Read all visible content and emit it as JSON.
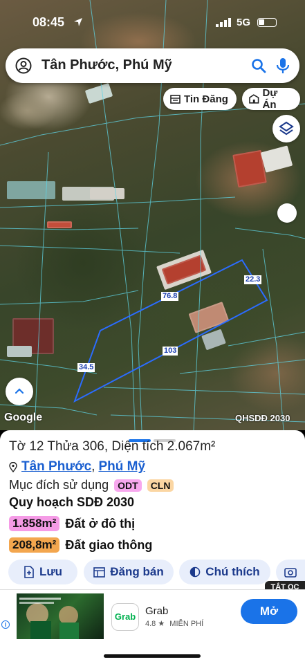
{
  "status_bar": {
    "time": "08:45",
    "network": "5G"
  },
  "search": {
    "text": "Tân Phước, Phú Mỹ"
  },
  "map_chips": {
    "listings": "Tin Đăng",
    "projects": "Dự Án"
  },
  "map": {
    "parcel_dimensions": [
      "76.8",
      "22.3",
      "103",
      "34.5"
    ],
    "google_label": "Google",
    "plan_label": "QHSDĐ 2030",
    "boundary_color": "#2b6cff"
  },
  "sheet": {
    "title": "Tờ 12 Thửa 306, Diện tích 2.067m²",
    "place_ward": "Tân Phước",
    "place_separator": ",",
    "place_town": "Phú Mỹ",
    "purpose_label": "Mục đích sử dụng",
    "purpose_tags": [
      "ODT",
      "CLN"
    ],
    "plan_title": "Quy hoạch SDĐ 2030",
    "areas": [
      {
        "value": "1.858m²",
        "label": "Đất ở đô thị",
        "color": "#f59be6"
      },
      {
        "value": "208,8m²",
        "label": "Đất giao thông",
        "color": "#f3a64e"
      }
    ],
    "actions": {
      "save": "Lưu",
      "post": "Đăng bán",
      "legend": "Chú thích"
    }
  },
  "ad": {
    "close_label": "TẮT QC",
    "app_name": "Grab",
    "app_icon_text": "Grab",
    "rating": "4.8 ★",
    "price": "MIỄN PHÍ",
    "open_label": "Mở"
  }
}
